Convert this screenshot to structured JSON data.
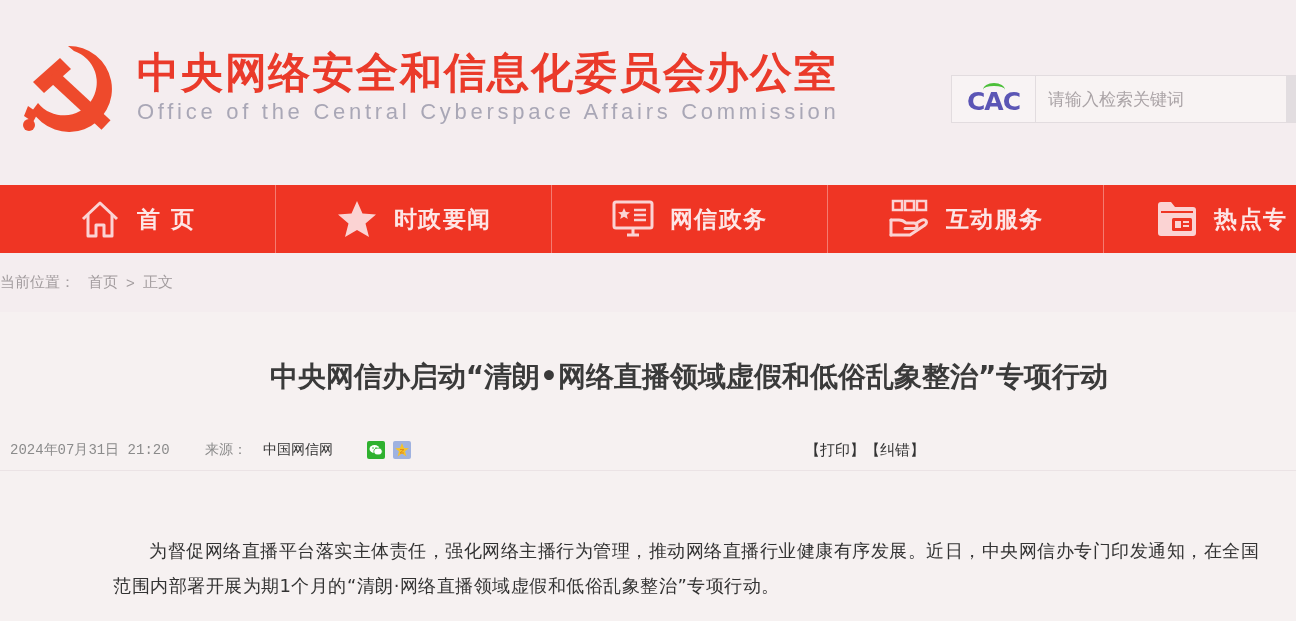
{
  "header": {
    "title": "中央网络安全和信息化委员会办公室",
    "subtitle": "Office of the Central Cyberspace Affairs Commission"
  },
  "search": {
    "logo": "CAC",
    "placeholder": "请输入检索关键词"
  },
  "nav": [
    {
      "label": "首 页"
    },
    {
      "label": "时政要闻"
    },
    {
      "label": "网信政务"
    },
    {
      "label": "互动服务"
    },
    {
      "label": "热点专"
    }
  ],
  "breadcrumb": {
    "label": "当前位置：",
    "items": [
      "首页",
      "正文"
    ],
    "separator": ">"
  },
  "article": {
    "title": "中央网信办启动“清朗•网络直播领域虚假和低俗乱象整治”专项行动",
    "date": "2024年07月31日 21:20",
    "source_label": "来源：",
    "source": "中国网信网",
    "actions": [
      "【打印】",
      "【纠错】"
    ],
    "paragraphs": [
      "为督促网络直播平台落实主体责任，强化网络主播行为管理，推动网络直播行业健康有序发展。近日，中央网信办专门印发通知，在全国范围内部署开展为期1个月的“清朗·网络直播领域虚假和低俗乱象整治”专项行动。"
    ]
  }
}
